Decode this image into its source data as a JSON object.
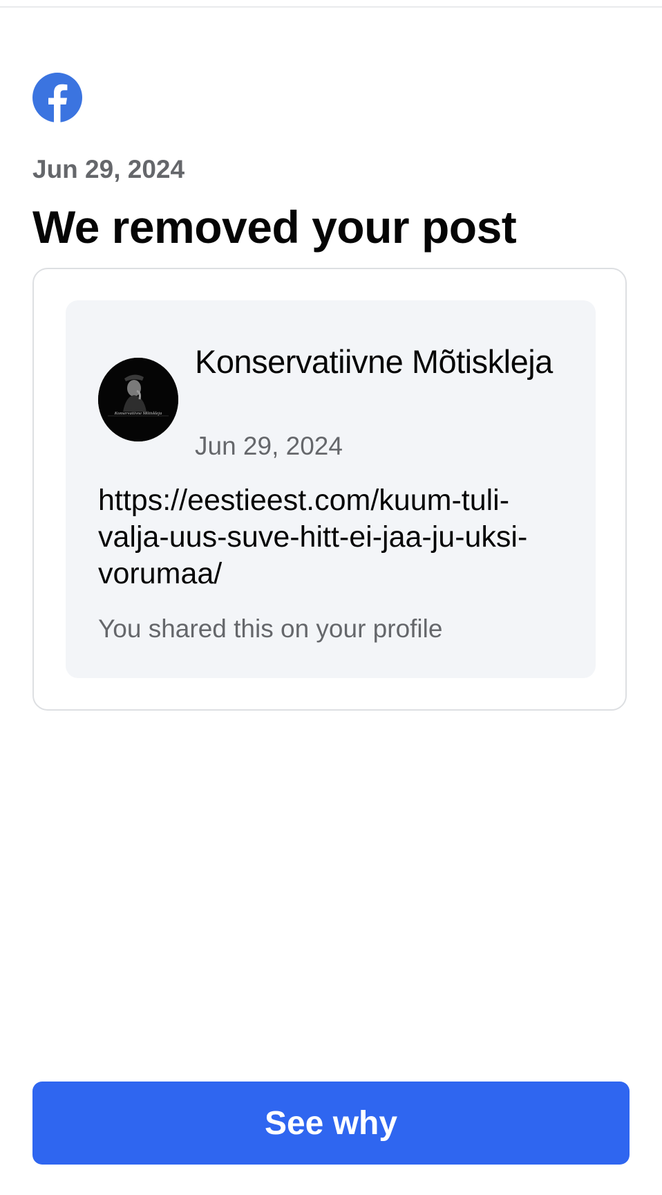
{
  "header": {
    "logo_icon": "facebook-logo-icon",
    "brand_color": "#3b74e0",
    "date": "Jun 29, 2024",
    "title": "We removed your post"
  },
  "post": {
    "avatar_icon": "profile-avatar",
    "avatar_caption": "Konservatiivne Mõtiskleja",
    "author": "Konservatiivne Mõtiskleja",
    "date": "Jun 29, 2024",
    "link": "https://eestieest.com/kuum-tuli-valja-uus-suve-hitt-ei-jaa-ju-uksi-vorumaa/",
    "note": "You shared this on your profile"
  },
  "actions": {
    "primary_label": "See why",
    "primary_color": "#2f66f0"
  }
}
